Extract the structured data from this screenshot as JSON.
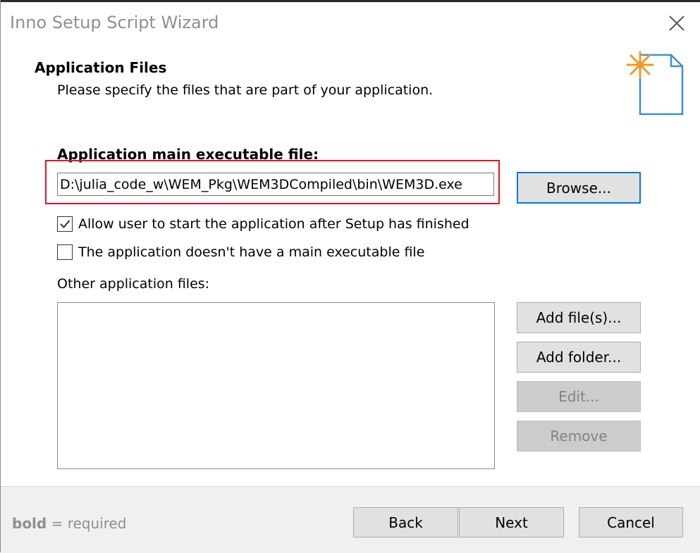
{
  "window": {
    "title": "Inno Setup Script Wizard"
  },
  "header": {
    "title": "Application Files",
    "subtitle": "Please specify the files that are part of your application."
  },
  "main_exe": {
    "label": "Application main executable file:",
    "value": "D:\\julia_code_w\\WEM_Pkg\\WEM3DCompiled\\bin\\WEM3D.exe",
    "browse_label": "Browse..."
  },
  "options": {
    "allow_start_label": "Allow user to start the application after Setup has finished",
    "allow_start_checked": true,
    "no_exe_label": "The application doesn't have a main executable file",
    "no_exe_checked": false
  },
  "other_files": {
    "label": "Other application files:",
    "items": [],
    "add_files_label": "Add file(s)...",
    "add_folder_label": "Add folder...",
    "edit_label": "Edit...",
    "remove_label": "Remove"
  },
  "footer": {
    "required_bold": "bold",
    "required_rest": " = required",
    "back_label": "Back",
    "next_label": "Next",
    "cancel_label": "Cancel"
  },
  "colors": {
    "highlight_box": "#e81123",
    "focus_border": "#0078d7",
    "icon_star": "#f39a1e",
    "icon_doc": "#3a8fd8"
  }
}
